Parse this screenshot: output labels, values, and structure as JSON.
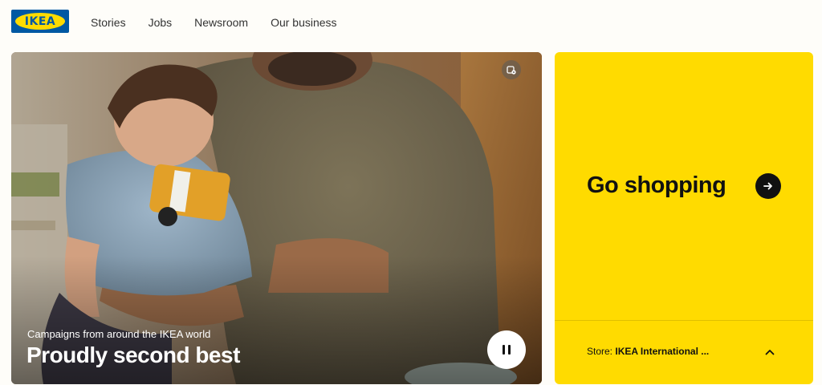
{
  "brand": {
    "logo_text": "IKEA",
    "blue": "#0058a3",
    "yellow": "#ffdb00"
  },
  "nav": {
    "items": [
      {
        "label": "Stories"
      },
      {
        "label": "Jobs"
      },
      {
        "label": "Newsroom"
      },
      {
        "label": "Our business"
      }
    ]
  },
  "hero": {
    "kicker": "Campaigns from around the IKEA world",
    "title": "Proudly second best",
    "pause_icon": "pause-icon",
    "media_icon": "media-settings-icon"
  },
  "shopping": {
    "title": "Go shopping",
    "arrow_icon": "arrow-right-icon",
    "store_label": "Store: ",
    "store_name": "IKEA International ...",
    "chevron_icon": "chevron-up-icon"
  }
}
